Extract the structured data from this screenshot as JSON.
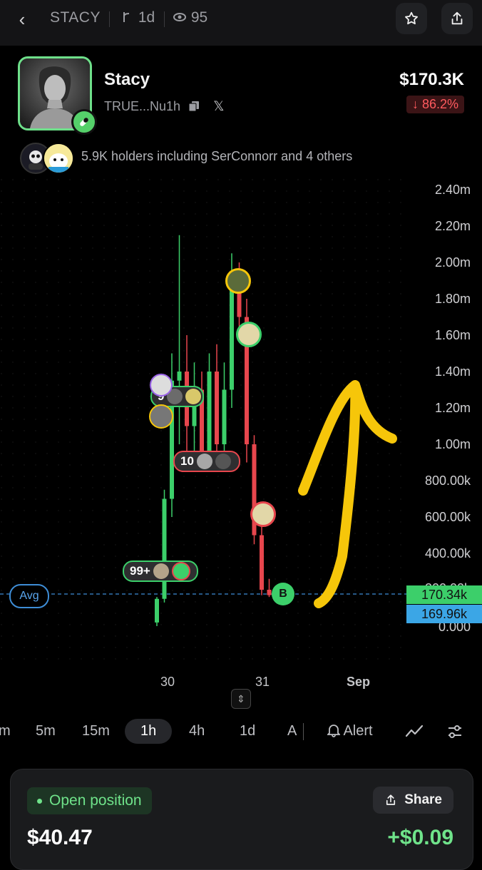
{
  "header": {
    "ticker": "STACY",
    "timeframe": "1d",
    "views": "95",
    "back_icon": "chevron-left-icon",
    "star_icon": "star-icon",
    "share_icon": "share-icon"
  },
  "token": {
    "name": "Stacy",
    "address": "TRUE...Nu1h",
    "price": "$170.3K",
    "change": "↓ 86.2%",
    "holders_text": "5.9K holders including SerConnorr and 4 others"
  },
  "chart": {
    "y_labels": [
      "2.40m",
      "2.20m",
      "2.00m",
      "1.80m",
      "1.60m",
      "1.40m",
      "1.20m",
      "1.00m",
      "800.00k",
      "600.00k",
      "400.00k",
      "200.00k",
      "0.000"
    ],
    "x_labels": [
      "30",
      "31",
      "Sep"
    ],
    "avg_label": "Avg",
    "current_price_tag": "170.34k",
    "avg_price_tag": "169.96k",
    "bubbles": [
      {
        "label": "9"
      },
      {
        "label": "10"
      },
      {
        "label": "99+"
      },
      {
        "label": "B"
      }
    ],
    "colors": {
      "up": "#3ccf6a",
      "down": "#e7464d",
      "annotation": "#f6c60a",
      "avg_line": "#3e8dd6"
    }
  },
  "chart_data": {
    "type": "candlestick",
    "y_range": [
      0,
      2400000
    ],
    "x_ticks": [
      "30",
      "31",
      "Sep"
    ],
    "candles": [
      {
        "open": 20000,
        "high": 160000,
        "low": 0,
        "close": 150000
      },
      {
        "open": 150000,
        "high": 750000,
        "low": 130000,
        "close": 700000
      },
      {
        "open": 700000,
        "high": 1500000,
        "low": 600000,
        "close": 1350000
      },
      {
        "open": 1350000,
        "high": 2150000,
        "low": 1000000,
        "close": 1400000
      },
      {
        "open": 1400000,
        "high": 1600000,
        "low": 950000,
        "close": 1100000
      },
      {
        "open": 1100000,
        "high": 1450000,
        "low": 900000,
        "close": 1300000
      },
      {
        "open": 1300000,
        "high": 1400000,
        "low": 850000,
        "close": 950000
      },
      {
        "open": 950000,
        "high": 1500000,
        "low": 900000,
        "close": 1400000
      },
      {
        "open": 1400000,
        "high": 1550000,
        "low": 900000,
        "close": 1000000
      },
      {
        "open": 1000000,
        "high": 1450000,
        "low": 950000,
        "close": 1300000
      },
      {
        "open": 1300000,
        "high": 2050000,
        "low": 1200000,
        "close": 1950000
      },
      {
        "open": 1950000,
        "high": 2000000,
        "low": 1600000,
        "close": 1700000
      },
      {
        "open": 1700000,
        "high": 1800000,
        "low": 900000,
        "close": 1000000
      },
      {
        "open": 1000000,
        "high": 1050000,
        "low": 450000,
        "close": 500000
      },
      {
        "open": 500000,
        "high": 550000,
        "low": 170000,
        "close": 200000
      },
      {
        "open": 200000,
        "high": 260000,
        "low": 160000,
        "close": 170340
      }
    ]
  },
  "intervals": {
    "items": [
      "m",
      "5m",
      "15m",
      "1h",
      "4h",
      "1d",
      "A"
    ],
    "selected": "1h",
    "alert_label": "Alert"
  },
  "position": {
    "open_label": "Open position",
    "share_label": "Share",
    "value": "$40.47",
    "pnl": "+$0.09"
  }
}
